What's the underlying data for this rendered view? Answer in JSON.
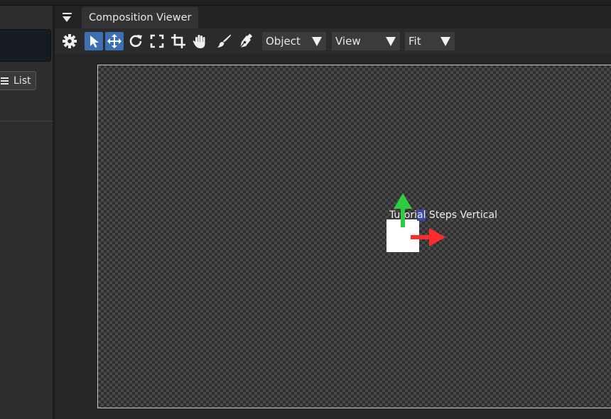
{
  "app": {
    "colors": {
      "accent": "#3d6fb3",
      "gizmo_y": "#2ecc40",
      "gizmo_x": "#ff2a2a",
      "selection": "#3b46b0"
    }
  },
  "left_panel": {
    "list_button_label": "List",
    "list_icon": "list-icon"
  },
  "viewer": {
    "tab_title": "Composition Viewer",
    "tab_menu_icon": "panel-menu-icon",
    "toolbar": {
      "tools": [
        {
          "icon": "gear-icon",
          "active": false
        },
        {
          "icon": "select-arrow-icon",
          "active": true
        },
        {
          "icon": "move-icon",
          "active": true
        },
        {
          "icon": "rotate-icon",
          "active": false
        },
        {
          "icon": "scale-bounds-icon",
          "active": false
        },
        {
          "icon": "crop-icon",
          "active": false
        },
        {
          "icon": "hand-icon",
          "active": false
        },
        {
          "icon": "brush-icon",
          "active": false
        },
        {
          "icon": "pen-icon",
          "active": false
        }
      ],
      "object_dropdown": "Object",
      "view_dropdown": "View",
      "zoom_dropdown": "Fit"
    },
    "canvas": {
      "layer_label_prefix": "Tu",
      "layer_label_mid": "tori",
      "layer_label_selected": "al",
      "layer_label_suffix": " Steps Vertical"
    }
  }
}
